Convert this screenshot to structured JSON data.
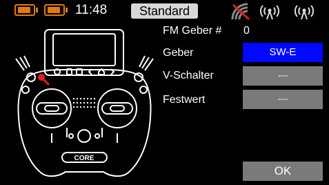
{
  "status": {
    "time": "11:48",
    "mode": "Standard",
    "icons": [
      "battery-icon",
      "battery-icon",
      "signal-disabled-icon",
      "antenna-icon",
      "antenna-icon"
    ]
  },
  "radio": {
    "logo": "CORE"
  },
  "form": {
    "fm_label": "FM Geber #",
    "fm_value": "0",
    "geber_label": "Geber",
    "geber_value": "SW-E",
    "vschalter_label": "V-Schalter",
    "vschalter_value": "---",
    "festwert_label": "Festwert",
    "festwert_value": "---"
  },
  "ok_label": "OK",
  "colors": {
    "accent": "#0008ff",
    "battery": "#e07b12",
    "field": "#7a7a7a",
    "highlight": "#e0201a"
  }
}
